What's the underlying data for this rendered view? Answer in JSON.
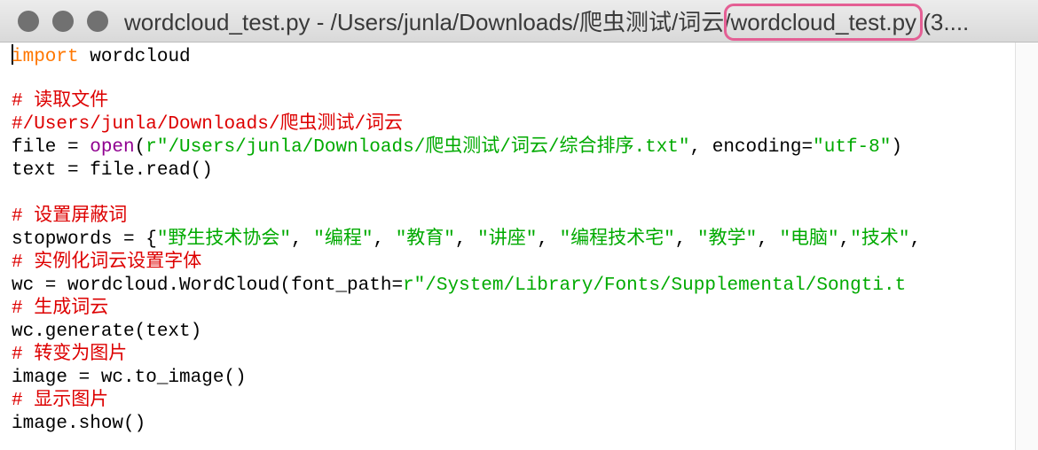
{
  "window": {
    "title_prefix": "wordcloud_test.py - /Users/junla/Downloads/爬虫测试/词云/",
    "title_highlight": "wordcloud_test.py",
    "title_suffix": " (3....",
    "highlight_color": "#e45f94"
  },
  "colors": {
    "keyword": "#ff7700",
    "builtin": "#900090",
    "string": "#00aa00",
    "comment": "#dd0000",
    "default": "#000000"
  },
  "editor": {
    "lines": [
      [
        {
          "t": "import",
          "c": "keyword"
        },
        {
          "t": " wordcloud",
          "c": "default"
        }
      ],
      [],
      [
        {
          "t": "# 读取文件",
          "c": "comment"
        }
      ],
      [
        {
          "t": "#/Users/junla/Downloads/爬虫测试/词云",
          "c": "comment"
        }
      ],
      [
        {
          "t": "file = ",
          "c": "default"
        },
        {
          "t": "open",
          "c": "builtin"
        },
        {
          "t": "(",
          "c": "default"
        },
        {
          "t": "r\"/Users/junla/Downloads/爬虫测试/词云/综合排序.txt\"",
          "c": "string"
        },
        {
          "t": ", encoding=",
          "c": "default"
        },
        {
          "t": "\"utf-8\"",
          "c": "string"
        },
        {
          "t": ")",
          "c": "default"
        }
      ],
      [
        {
          "t": "text = file.read()",
          "c": "default"
        }
      ],
      [],
      [
        {
          "t": "# 设置屏蔽词",
          "c": "comment"
        }
      ],
      [
        {
          "t": "stopwords = {",
          "c": "default"
        },
        {
          "t": "\"野生技术协会\"",
          "c": "string"
        },
        {
          "t": ", ",
          "c": "default"
        },
        {
          "t": "\"编程\"",
          "c": "string"
        },
        {
          "t": ", ",
          "c": "default"
        },
        {
          "t": "\"教育\"",
          "c": "string"
        },
        {
          "t": ", ",
          "c": "default"
        },
        {
          "t": "\"讲座\"",
          "c": "string"
        },
        {
          "t": ", ",
          "c": "default"
        },
        {
          "t": "\"编程技术宅\"",
          "c": "string"
        },
        {
          "t": ", ",
          "c": "default"
        },
        {
          "t": "\"教学\"",
          "c": "string"
        },
        {
          "t": ", ",
          "c": "default"
        },
        {
          "t": "\"电脑\"",
          "c": "string"
        },
        {
          "t": ",",
          "c": "default"
        },
        {
          "t": "\"技术\"",
          "c": "string"
        },
        {
          "t": ",",
          "c": "default"
        }
      ],
      [
        {
          "t": "# 实例化词云设置字体",
          "c": "comment"
        }
      ],
      [
        {
          "t": "wc = wordcloud.WordCloud(font_path=",
          "c": "default"
        },
        {
          "t": "r\"/System/Library/Fonts/Supplemental/Songti.t",
          "c": "string"
        }
      ],
      [
        {
          "t": "# 生成词云",
          "c": "comment"
        }
      ],
      [
        {
          "t": "wc.generate(text)",
          "c": "default"
        }
      ],
      [
        {
          "t": "# 转变为图片",
          "c": "comment"
        }
      ],
      [
        {
          "t": "image = wc.to_image()",
          "c": "default"
        }
      ],
      [
        {
          "t": "# 显示图片",
          "c": "comment"
        }
      ],
      [
        {
          "t": "image.show()",
          "c": "default"
        }
      ]
    ]
  }
}
